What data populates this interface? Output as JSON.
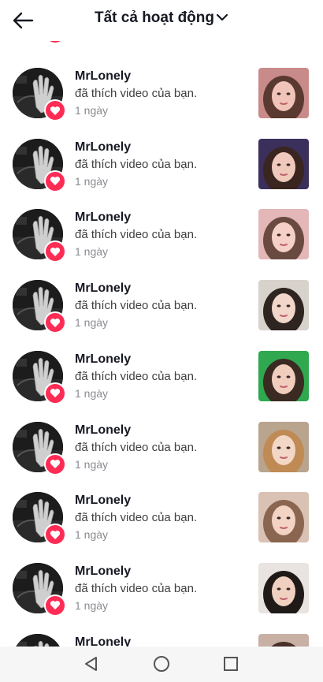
{
  "header": {
    "title": "Tất cả hoạt động",
    "back_icon": "arrow-left-icon",
    "dropdown_icon": "chevron-down-icon"
  },
  "colors": {
    "heart": "#fe2c55",
    "text": "#161823",
    "secondary": "#8a8b91"
  },
  "notifications": [
    {
      "username": "MrLonely",
      "action": "đã thích video của bạn.",
      "time": "1 ngày",
      "thumb_bg": "#c98a8a",
      "thumb_face": "#f0c4b8",
      "thumb_hair": "#5a3a30"
    },
    {
      "username": "MrLonely",
      "action": "đã thích video của bạn.",
      "time": "1 ngày",
      "thumb_bg": "#3b2f5c",
      "thumb_face": "#efc9bb",
      "thumb_hair": "#3a2520"
    },
    {
      "username": "MrLonely",
      "action": "đã thích video của bạn.",
      "time": "1 ngày",
      "thumb_bg": "#e3b7b7",
      "thumb_face": "#f4d0c6",
      "thumb_hair": "#6a4a40"
    },
    {
      "username": "MrLonely",
      "action": "đã thích video của bạn.",
      "time": "1 ngày",
      "thumb_bg": "#d8d2cc",
      "thumb_face": "#f1d6c9",
      "thumb_hair": "#2e2420"
    },
    {
      "username": "MrLonely",
      "action": "đã thích video của bạn.",
      "time": "1 ngày",
      "thumb_bg": "#2fa84f",
      "thumb_face": "#f0cdbd",
      "thumb_hair": "#3a2a22"
    },
    {
      "username": "MrLonely",
      "action": "đã thích video của bạn.",
      "time": "1 ngày",
      "thumb_bg": "#b9a48e",
      "thumb_face": "#f3d7c6",
      "thumb_hair": "#c08a55"
    },
    {
      "username": "MrLonely",
      "action": "đã thích video của bạn.",
      "time": "1 ngày",
      "thumb_bg": "#d9c1b4",
      "thumb_face": "#f2d3c4",
      "thumb_hair": "#8a6550"
    },
    {
      "username": "MrLonely",
      "action": "đã thích video của bạn.",
      "time": "1 ngày",
      "thumb_bg": "#e9e4e1",
      "thumb_face": "#f0d0c0",
      "thumb_hair": "#1f1a18"
    },
    {
      "username": "MrLonely",
      "action": "",
      "time": "",
      "thumb_bg": "#c8b0a5",
      "thumb_face": "#efcdbd",
      "thumb_hair": "#4a3028"
    }
  ],
  "navbar": {
    "back_icon": "triangle-back-icon",
    "home_icon": "circle-home-icon",
    "recents_icon": "square-recents-icon"
  }
}
